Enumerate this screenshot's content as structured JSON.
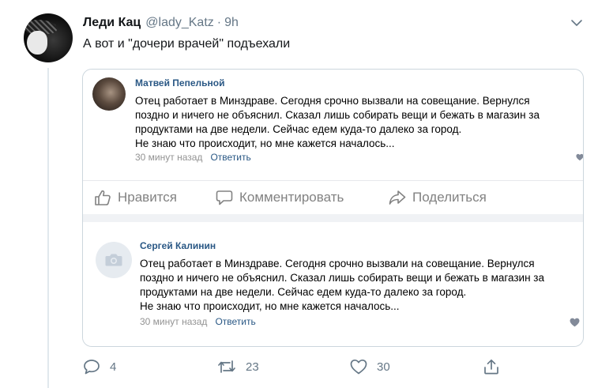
{
  "tweet": {
    "author_name": "Леди Кац",
    "author_handle": "@lady_Katz",
    "separator": "·",
    "time": "9h",
    "text": "А вот и \"дочери врачей\" подъехали"
  },
  "embedded": {
    "post": {
      "author": "Матвей Пепельной",
      "lines": [
        "Отец работает в Минздраве. Сегодня срочно вызвали на совещание. Вернулся",
        "поздно и ничего не объяснил. Сказал лишь собирать вещи и бежать в магазин за",
        "продуктами на две недели. Сейчас едем куда-то далеко за город.",
        "Не знаю что происходит, но мне кажется началось..."
      ],
      "time_ago": "30 минут назад",
      "reply_label": "Ответить"
    },
    "actions": {
      "like": "Нравится",
      "comment": "Комментировать",
      "share": "Поделиться"
    },
    "comment": {
      "author": "Сергей Калинин",
      "lines": [
        "Отец работает в Минздраве. Сегодня срочно вызвали на совещание. Вернулся",
        "поздно и ничего не объяснил. Сказал лишь собирать вещи и бежать в магазин за",
        "продуктами на две недели. Сейчас едем куда-то далеко за город.",
        "Не знаю что происходит, но мне кажется началось..."
      ],
      "time_ago": "30 минут назад",
      "reply_label": "Ответить"
    }
  },
  "tweet_actions": {
    "replies": "4",
    "retweets": "23",
    "likes": "30"
  },
  "icons": {
    "reply": "reply-icon",
    "retweet": "retweet-icon",
    "like": "heart-icon",
    "share": "share-icon",
    "menu": "chevron-down-icon",
    "camera": "camera-icon"
  },
  "colors": {
    "vk_link": "#2a5885",
    "twitter_gray": "#657786"
  }
}
